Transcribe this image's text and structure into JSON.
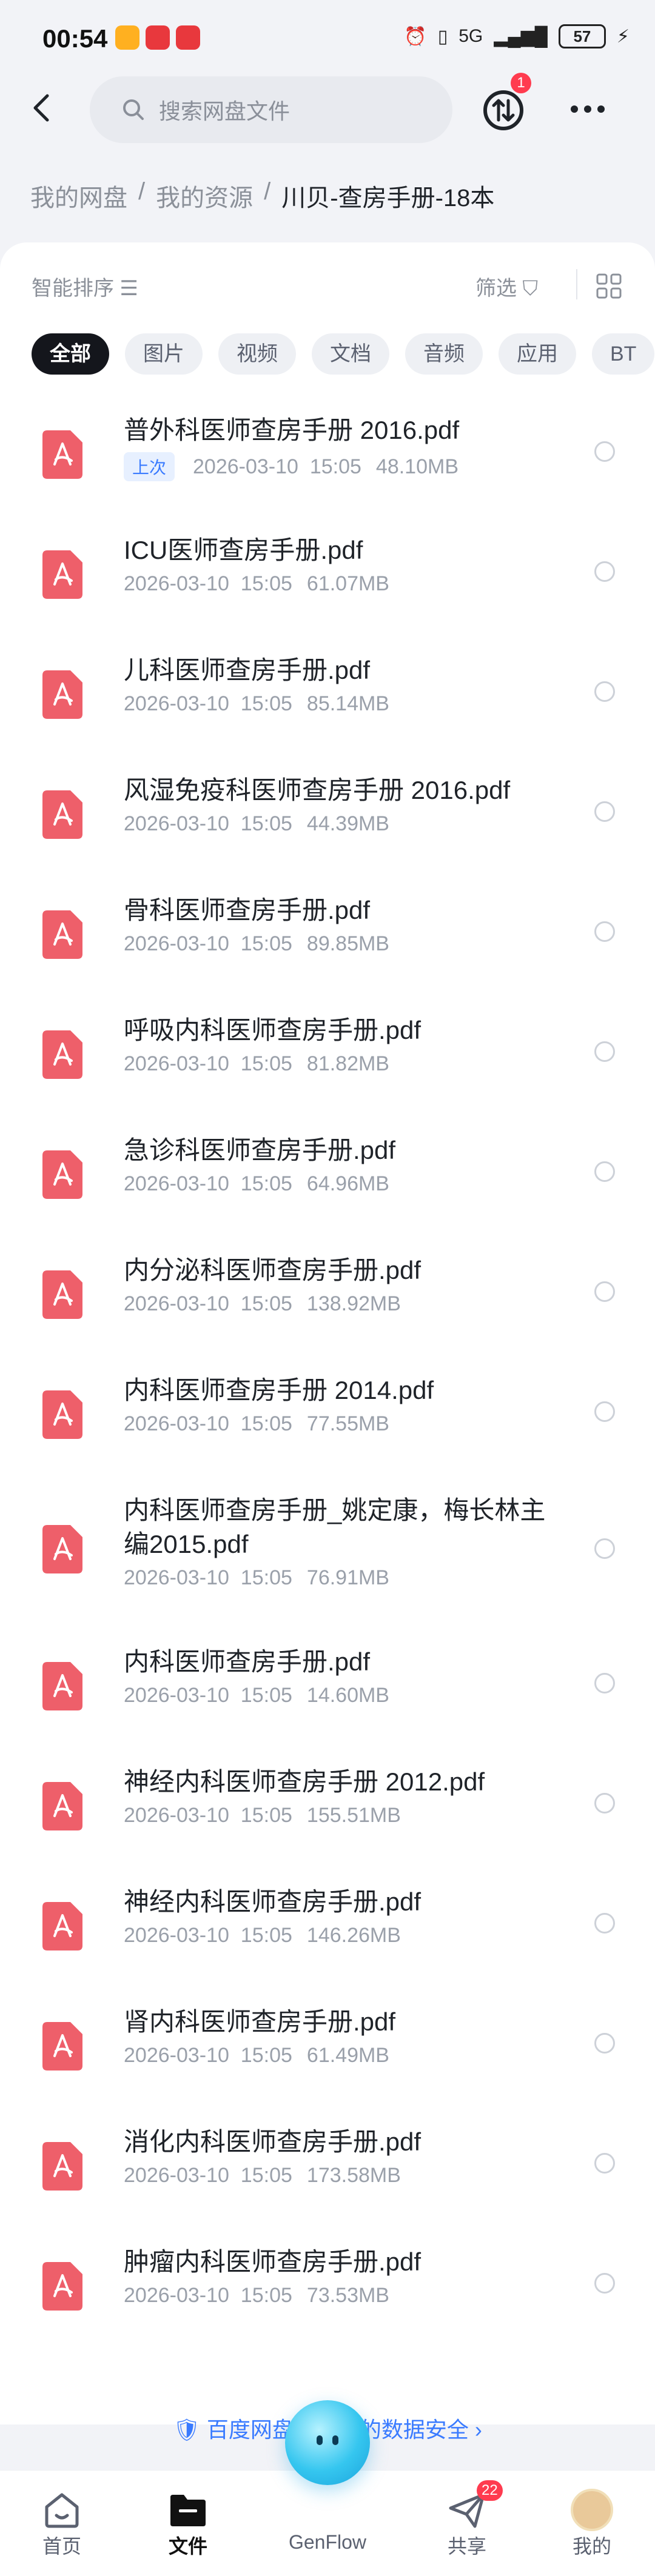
{
  "status": {
    "time": "00:54",
    "network": "5G",
    "battery": "57"
  },
  "search": {
    "placeholder": "搜索网盘文件"
  },
  "transfer_badge": "1",
  "breadcrumb": [
    "我的网盘",
    "我的资源",
    "川贝-查房手册-18本"
  ],
  "toolbar": {
    "sort_label": "智能排序",
    "filter_label": "筛选"
  },
  "tabs": [
    "全部",
    "图片",
    "视频",
    "文档",
    "音频",
    "应用",
    "BT"
  ],
  "files": [
    {
      "name": "普外科医师查房手册 2016.pdf",
      "tag": "上次",
      "date": "2026-03-10  15:05",
      "size": "48.10MB"
    },
    {
      "name": "ICU医师查房手册.pdf",
      "date": "2026-03-10  15:05",
      "size": "61.07MB"
    },
    {
      "name": "儿科医师查房手册.pdf",
      "date": "2026-03-10  15:05",
      "size": "85.14MB"
    },
    {
      "name": "风湿免疫科医师查房手册 2016.pdf",
      "date": "2026-03-10  15:05",
      "size": "44.39MB"
    },
    {
      "name": "骨科医师查房手册.pdf",
      "date": "2026-03-10  15:05",
      "size": "89.85MB"
    },
    {
      "name": "呼吸内科医师查房手册.pdf",
      "date": "2026-03-10  15:05",
      "size": "81.82MB"
    },
    {
      "name": "急诊科医师查房手册.pdf",
      "date": "2026-03-10  15:05",
      "size": "64.96MB"
    },
    {
      "name": "内分泌科医师查房手册.pdf",
      "date": "2026-03-10  15:05",
      "size": "138.92MB"
    },
    {
      "name": "内科医师查房手册 2014.pdf",
      "date": "2026-03-10  15:05",
      "size": "77.55MB"
    },
    {
      "name": "内科医师查房手册_姚定康，梅长林主编2015.pdf",
      "date": "2026-03-10  15:05",
      "size": "76.91MB"
    },
    {
      "name": "内科医师查房手册.pdf",
      "date": "2026-03-10  15:05",
      "size": "14.60MB"
    },
    {
      "name": "神经内科医师查房手册 2012.pdf",
      "date": "2026-03-10  15:05",
      "size": "155.51MB"
    },
    {
      "name": "神经内科医师查房手册.pdf",
      "date": "2026-03-10  15:05",
      "size": "146.26MB"
    },
    {
      "name": "肾内科医师查房手册.pdf",
      "date": "2026-03-10  15:05",
      "size": "61.49MB"
    },
    {
      "name": "消化内科医师查房手册.pdf",
      "date": "2026-03-10  15:05",
      "size": "173.58MB"
    },
    {
      "name": "肿瘤内科医师查房手册.pdf",
      "date": "2026-03-10  15:05",
      "size": "73.53MB"
    }
  ],
  "safety_text": "百度网盘保障你的数据安全",
  "nav": {
    "items": [
      "首页",
      "文件",
      "GenFlow",
      "共享",
      "我的"
    ],
    "share_badge": "22"
  },
  "colors": {
    "accent": "#3a7bff",
    "pdf": "#ee5f6a",
    "active_tab": "#14161c"
  }
}
